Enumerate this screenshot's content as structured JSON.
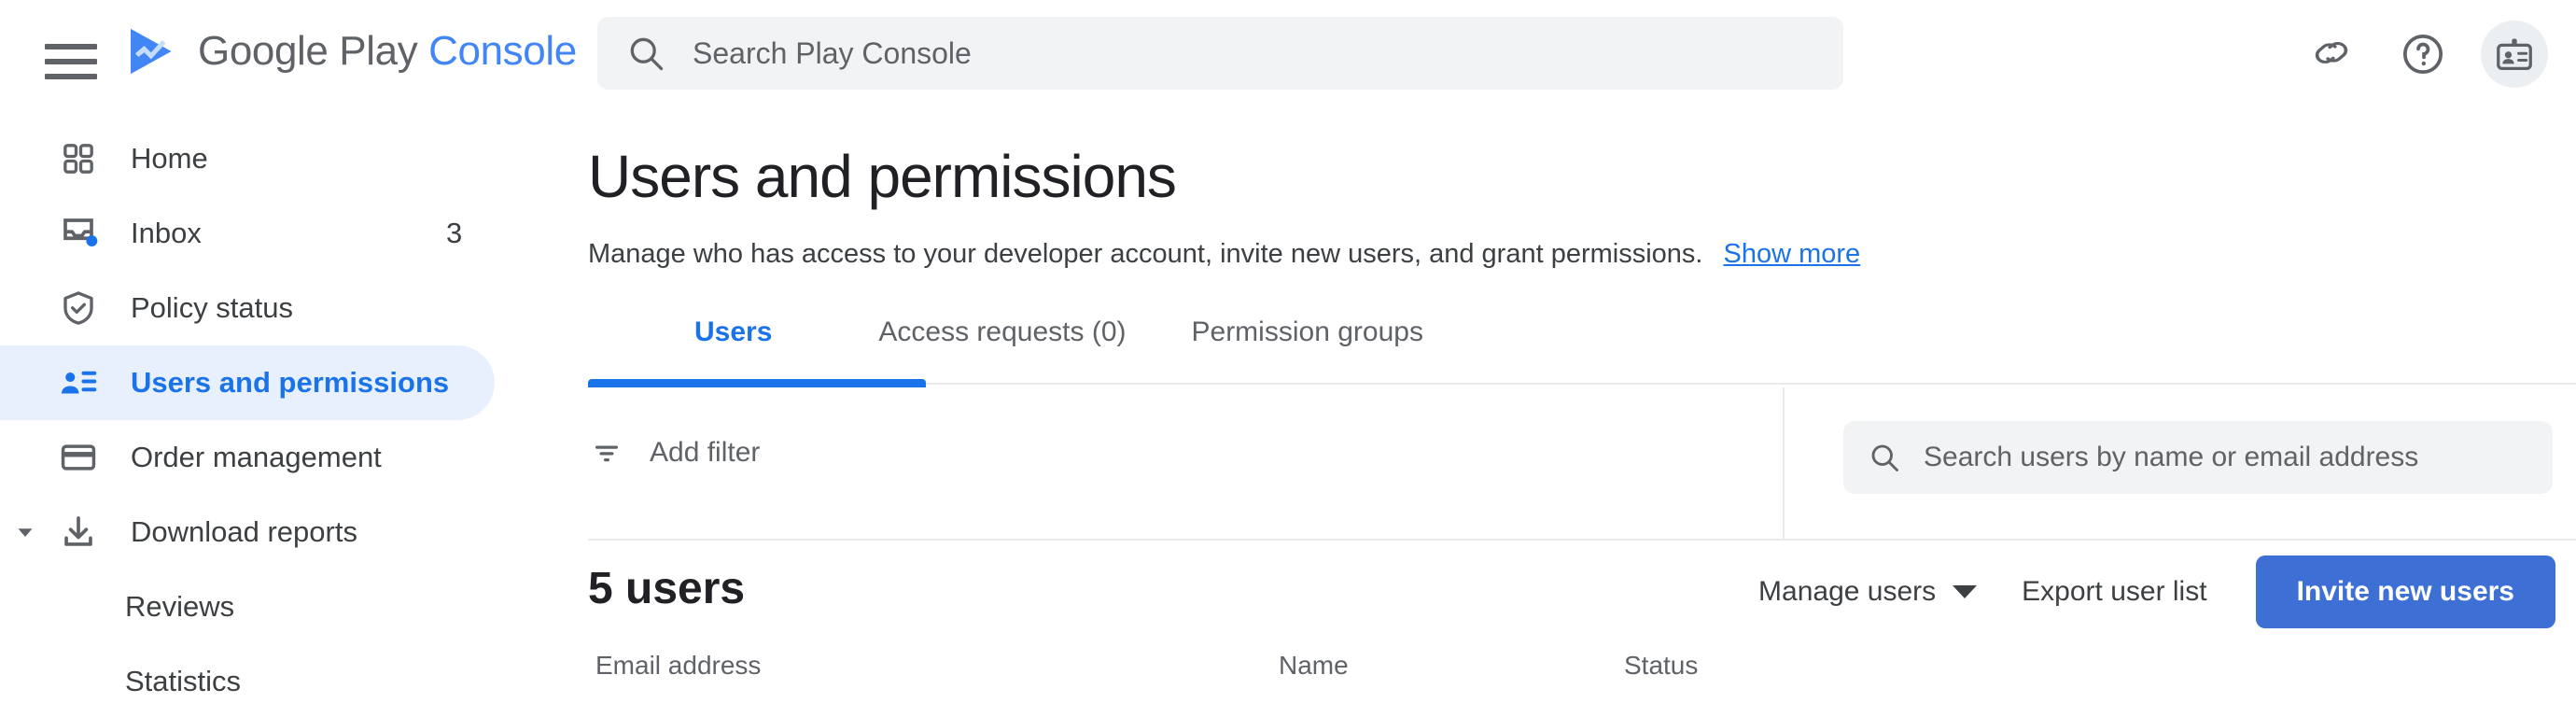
{
  "topbar": {
    "menu_icon": "hamburger-menu-icon",
    "brand_primary": "Google Play",
    "brand_secondary": "Console",
    "logo_icon": "google-play-logo",
    "search": {
      "icon": "search-icon",
      "placeholder": "Search Play Console",
      "value": ""
    },
    "actions": [
      {
        "icon": "link-icon",
        "name": "copy-link-button"
      },
      {
        "icon": "help-circle-icon",
        "name": "help-button"
      },
      {
        "icon": "account-badge-icon",
        "name": "account-badge-button"
      }
    ]
  },
  "sidebar": {
    "items": [
      {
        "label": "Home",
        "icon": "grid-apps-icon",
        "active": false,
        "badge": "",
        "sub": false,
        "caret": false
      },
      {
        "label": "Inbox",
        "icon": "inbox-tray-icon",
        "active": false,
        "badge": "3",
        "sub": false,
        "caret": false
      },
      {
        "label": "Policy status",
        "icon": "shield-check-icon",
        "active": false,
        "badge": "",
        "sub": false,
        "caret": false
      },
      {
        "label": "Users and permissions",
        "icon": "person-list-icon",
        "active": true,
        "badge": "",
        "sub": false,
        "caret": false
      },
      {
        "label": "Order management",
        "icon": "credit-card-icon",
        "active": false,
        "badge": "",
        "sub": false,
        "caret": false
      },
      {
        "label": "Download reports",
        "icon": "download-icon",
        "active": false,
        "badge": "",
        "sub": false,
        "caret": true
      },
      {
        "label": "Reviews",
        "icon": "",
        "active": false,
        "badge": "",
        "sub": true,
        "caret": false
      },
      {
        "label": "Statistics",
        "icon": "",
        "active": false,
        "badge": "",
        "sub": true,
        "caret": false
      }
    ]
  },
  "main": {
    "title": "Users and permissions",
    "description": "Manage who has access to your developer account, invite new users, and grant permissions.",
    "show_more": "Show more",
    "tabs": [
      {
        "label": "Users",
        "active": true
      },
      {
        "label": "Access requests (0)",
        "active": false
      },
      {
        "label": "Permission groups",
        "active": false
      }
    ],
    "filter": {
      "icon": "filter-list-icon",
      "label": "Add filter"
    },
    "user_search": {
      "icon": "search-icon",
      "placeholder": "Search users by name or email address",
      "value": ""
    },
    "count_label": "5 users",
    "manage_users": "Manage users",
    "export_user_list": "Export user list",
    "invite_new_users": "Invite new users",
    "table_headers": {
      "email": "Email address",
      "name": "Name",
      "status": "Status"
    }
  },
  "colors": {
    "accent_blue": "#1a73e8",
    "button_blue": "#3d6fd4",
    "active_pill": "#e8f0fe",
    "text_primary": "#202124",
    "text_secondary": "#5f6368",
    "field_bg": "#f1f3f4",
    "divider": "#e8eaed"
  }
}
